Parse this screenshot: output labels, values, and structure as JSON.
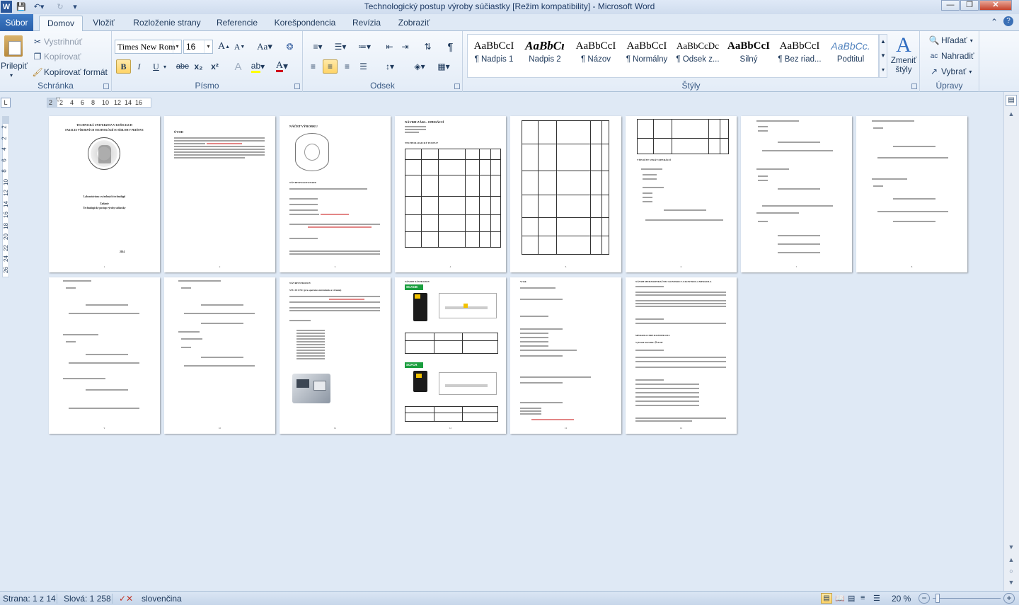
{
  "window": {
    "title": "Technologický postup výroby súčiastky [Režim kompatibility]  -  Microsoft Word",
    "app_icon": "W"
  },
  "tabs": {
    "file": "Súbor",
    "items": [
      "Domov",
      "Vložiť",
      "Rozloženie strany",
      "Referencie",
      "Korešpondencia",
      "Revízia",
      "Zobraziť"
    ],
    "active": "Domov"
  },
  "clipboard": {
    "paste": "Prilepiť",
    "cut": "Vystrihnúť",
    "copy": "Kopírovať",
    "format_painter": "Kopírovať formát",
    "label": "Schránka"
  },
  "font": {
    "name": "Times New Rom",
    "size": "16",
    "label": "Písmo",
    "grow": "A",
    "shrink": "A",
    "case": "Aa",
    "bold": "B",
    "italic": "I",
    "underline": "U",
    "strike": "abe",
    "sub": "x₂",
    "sup": "x²"
  },
  "paragraph": {
    "label": "Odsek"
  },
  "styles": {
    "label": "Štýly",
    "items": [
      {
        "preview": "AaBbCcI",
        "name": "¶ Nadpis 1"
      },
      {
        "preview": "AaBbCı",
        "name": "Nadpis 2"
      },
      {
        "preview": "AaBbCcI",
        "name": "¶ Názov"
      },
      {
        "preview": "AaBbCcI",
        "name": "¶ Normálny"
      },
      {
        "preview": "AaBbCcDc",
        "name": "¶ Odsek z..."
      },
      {
        "preview": "AaBbCcI",
        "name": "Silný"
      },
      {
        "preview": "AaBbCcI",
        "name": "¶ Bez riad..."
      },
      {
        "preview": "AaBbCc.",
        "name": "Podtitul"
      }
    ],
    "change_styles": "Zmeniť štýly"
  },
  "editing": {
    "label": "Úpravy",
    "find": "Hľadať",
    "replace": "Nahradiť",
    "select": "Vybrať"
  },
  "ruler": {
    "ticks": [
      "2",
      "2",
      "4",
      "6",
      "8",
      "10",
      "12",
      "14",
      "16"
    ],
    "vticks": [
      "2",
      "2",
      "4",
      "6",
      "8",
      "10",
      "12",
      "14",
      "16",
      "18",
      "20",
      "22",
      "24",
      "26"
    ]
  },
  "pages": [
    {
      "head": "TECHNICKÁ UNIVERZITA V KOŠICIACH"
    },
    {
      "head": "ÚVOD"
    },
    {
      "head": "NÁČRT VÝROBKU"
    },
    {
      "head": "NÁVRH ZÁKL. OPERÁCIÍ"
    },
    {
      "head": ""
    },
    {
      "head": "VÝPOČET STRÁT OPERÁCIÍ"
    },
    {
      "head": ""
    },
    {
      "head": ""
    },
    {
      "head": ""
    },
    {
      "head": ""
    },
    {
      "head": "NÁVRH STROJOV"
    },
    {
      "head": "NÁVRH NÁSTROJOV"
    },
    {
      "head": "Vrták"
    },
    {
      "head": "NÁVRH MEDZIOPERAČNEJ KONTROLY A KONTROLA MERADLA"
    }
  ],
  "page1": {
    "school": "TECHNICKÁ UNIVERZITA V KOŠICIACH",
    "faculty": "FAKULTA VÝROBNÝCH TECHNOLÓGIÍ SO SÍDLOM V PREŠOVE",
    "course": "Laboratórium z výrobných technológií",
    "subtitle": "Zadanie",
    "topic": "Technologický postup výroby súčiastky",
    "year": "2014"
  },
  "page11": {
    "subhead": "STL 30 CNC (pre operácie sústruženia a vŕtania)"
  },
  "page12": {
    "brand1": "SCACB",
    "brand2": "SCFCR"
  },
  "page13": {
    "drill": "Vrták"
  },
  "page14": {
    "sub": "NÁVRH MEDZIOPERAČNEJ KONTROLY A KONTROLA MERADLA",
    "meradlo": "MERADLO PRE ROZMER Ø16",
    "typ": "Vybrané meradlo:  ∅16 H7"
  },
  "status": {
    "page": "Strana: 1 z 14",
    "words": "Slová: 1 258",
    "language": "slovenčina",
    "zoom": "20 %"
  }
}
